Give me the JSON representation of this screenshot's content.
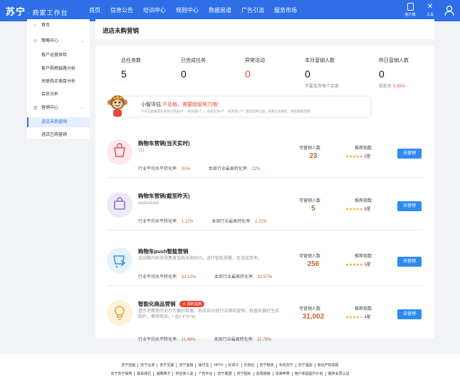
{
  "header": {
    "logo": "苏宁",
    "logo_sub": "· 商家工作台",
    "nav": [
      "首页",
      "信息公告",
      "培训中心",
      "规则中心",
      "数据易道",
      "广告引流",
      "服务市场"
    ],
    "tools": [
      "客户端",
      "工具"
    ]
  },
  "sidebar": {
    "items": [
      {
        "label": "首页",
        "icon": "home-icon"
      },
      {
        "label": "策略中心",
        "icon": "compass-icon",
        "group": true
      },
      {
        "label": "客户运营体检"
      },
      {
        "label": "客户购物链路分析"
      },
      {
        "label": "关联购买类目分析"
      },
      {
        "label": "会员分析"
      },
      {
        "label": "营销中心",
        "icon": "chart-icon",
        "group": true
      },
      {
        "label": "进店未购营销",
        "active": true
      },
      {
        "label": "进店已购营销"
      }
    ]
  },
  "page": {
    "title": "进店未购营销"
  },
  "stats": [
    {
      "label": "总任务数",
      "value": "5"
    },
    {
      "label": "已完成任务",
      "value": "0"
    },
    {
      "label": "异常活动",
      "value": "0",
      "red": true
    },
    {
      "label": "本月营销人数",
      "value": "0",
      "note": "不要放弃每个买家"
    },
    {
      "label": "昨日营销人数",
      "value": "0",
      "note_prefix": "较前天",
      "note_value": "0.00%",
      "note_arrow": "-"
    }
  ],
  "assessment": {
    "prefix": "小智评估:",
    "status": "不及格。需要超级努力哦!",
    "detail": "今日五星推荐任务共计完成0个（未完成4个），四星任务0个（未完成1个）建议您将五星，四星任务做完，继续做规范哦！"
  },
  "campaigns": [
    {
      "name": "购物车营销(当天实时)",
      "desc": "111",
      "avg_label": "行业平均水平转化率:",
      "avg": "32%",
      "max_label": "本周行业最高转化率:",
      "max": "22%",
      "sell_label": "可营销人数",
      "sell": "23",
      "idx_label": "推荐指数:",
      "stars": 5,
      "level": "5星",
      "button": "去营销",
      "icon": "cart-icon",
      "icon_bg": "#fde8ea",
      "icon_color": "#e0566a"
    },
    {
      "name": "购物车营销(截至昨天)",
      "desc": "asdasdasd",
      "avg_label": "行业平均水平转化率:",
      "avg": "1.11%",
      "max_label": "本周行业最高转化率:",
      "max": "2.22%",
      "sell_label": "可营销人数",
      "sell": "5",
      "idx_label": "推荐指数:",
      "stars": 5,
      "level": "5星",
      "button": "去营销",
      "icon": "bag-icon",
      "icon_bg": "#ede9fa",
      "icon_color": "#8a73d8"
    },
    {
      "name": "购物车push智能营销",
      "desc": "活动期内检测消费者加购未购时间，进行智能提醒，促进成单率。",
      "avg_label": "行业平均水平转化率:",
      "avg": "32.12%",
      "max_label": "本周行业最高转化率:",
      "max": "22.57%",
      "sell_label": "可营销人数",
      "sell": "256",
      "idx_label": "推荐指数:",
      "stars": 5,
      "level": "5星",
      "button": "去营销",
      "icon": "push-cart-icon",
      "icon_bg": "#e3f2fc",
      "icon_color": "#3a97d9"
    },
    {
      "name": "智能化商品营销",
      "badge": "⚡ 限时试用",
      "desc": "基于消费者历史行为偏好数据，系统自动进行店铺商营销，根据其偏好生成图片，推荐商品。! @#￥%^&(",
      "avg_label": "行业平均水平转化率:",
      "avg": "11.66%",
      "max_label": "本周行业最高转化率:",
      "max": "11.78%",
      "sell_label": "可营销人数",
      "sell": "31,002",
      "idx_label": "推荐指数:",
      "stars": 4,
      "level": "4星",
      "button": "去营销",
      "icon": "bulb-icon",
      "icon_bg": "#fdf2dc",
      "icon_color": "#e0a63a"
    }
  ],
  "footer": {
    "row1": [
      "苏宁控股",
      "苏宁云商",
      "苏宁互联",
      "苏宁金融",
      "易付宝",
      "PPTV",
      "红孩子",
      "乐购仕",
      "苏宁物流",
      "手机苏宁",
      "苏宁酒店",
      "知识产权举报"
    ],
    "row2": [
      "关于苏宁易购",
      "联系我们",
      "诚聘英才",
      "供应商入驻",
      "广告平台",
      "苏宁联盟",
      "苏宁招标",
      "友情链接",
      "法律申明",
      "用户体验提升计划",
      "服务会员认证"
    ]
  },
  "colors": {
    "primary": "#2e6fe8",
    "warning": "#e8473a",
    "accent": "#c4622d",
    "star": "#f5a623"
  }
}
